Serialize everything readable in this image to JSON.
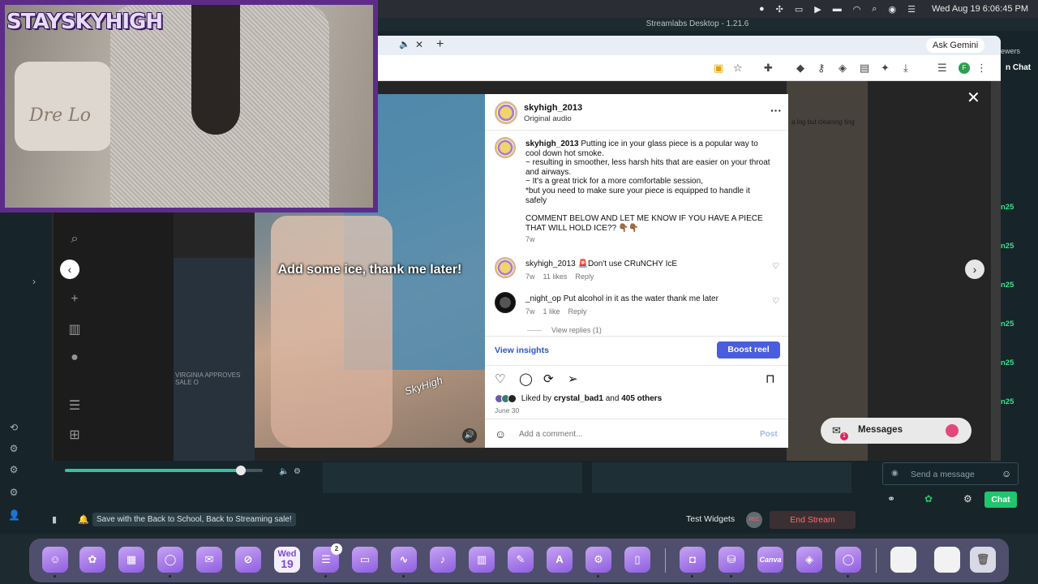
{
  "menubar": {
    "datetime": "Wed Aug 19  6:06:45 PM"
  },
  "streamlabs": {
    "window_title": "Streamlabs Desktop - 1.21.6",
    "viewers_label": "ewers",
    "chat_label": "n Chat",
    "chat_values": [
      "n25",
      "n25",
      "n25",
      "n25",
      "n25",
      "n25"
    ],
    "promo_text": "Save with the Back to School, Back to Streaming sale!",
    "test_widgets": "Test Widgets",
    "rec_label": "REC",
    "end_stream": "End Stream",
    "send_message_placeholder": "Send a message",
    "chat_button": "Chat",
    "audio_level": 0.89
  },
  "chrome": {
    "ask_gemini": "Ask Gemini",
    "profile_initial": "F"
  },
  "webcam": {
    "logo_text": "STAYSKYHIGH",
    "pillow_text": "Dre Lo"
  },
  "video": {
    "caption": "Add some ice, thank me later!",
    "watermark": "SkyHigh"
  },
  "background": {
    "news_text": "VIRGINIA APPROVES SALE O",
    "right_thumb_text": "a log but cleaning ting"
  },
  "post": {
    "username": "skyhigh_2013",
    "audio": "Original audio",
    "caption_username": "skyhigh_2013",
    "caption_lines": [
      "Putting ice in your glass piece is a popular way to cool down hot smoke.",
      "~ resulting in smoother, less harsh hits that are easier on your throat and airways.",
      "~ It's a great trick for a more comfortable session,",
      "*but you need to make sure your piece is equipped to handle it safely"
    ],
    "caption_cta": "COMMENT BELOW AND LET ME KNOW IF YOU HAVE A PIECE THAT WILL HOLD ICE?? 👇🏾👇🏾",
    "caption_time": "7w",
    "comments": [
      {
        "username": "skyhigh_2013",
        "text": "🚨Don't use CRuNCHY IcE",
        "time": "7w",
        "likes": "11 likes",
        "reply": "Reply"
      },
      {
        "username": "_night_op",
        "text": "Put alcohol in it as the water thank me later",
        "time": "7w",
        "likes": "1 like",
        "reply": "Reply"
      }
    ],
    "view_replies": "View replies (1)",
    "view_insights": "View insights",
    "boost_reel": "Boost reel",
    "liked_by_prefix": "Liked by",
    "liked_by_user": "crystal_bad1",
    "liked_by_and": "and",
    "liked_by_others": "405 others",
    "date": "June 30",
    "comment_placeholder": "Add a comment...",
    "post_button": "Post"
  },
  "messages": {
    "label": "Messages",
    "badge": "1"
  },
  "dock": {
    "calendar_day": "Wed",
    "calendar_date": "19",
    "reminders_badge": "2",
    "canva_label": "Canva"
  }
}
